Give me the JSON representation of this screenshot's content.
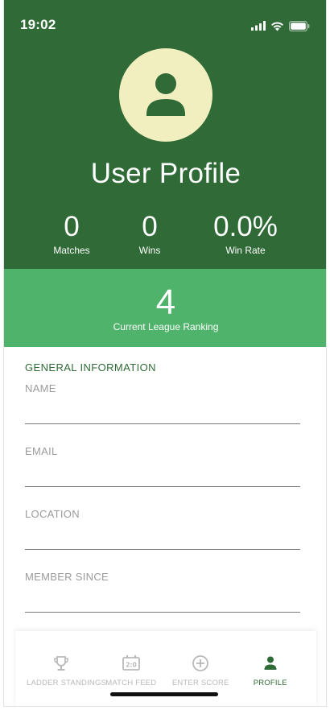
{
  "status_bar": {
    "time": "19:02"
  },
  "profile": {
    "title": "User Profile",
    "stats": [
      {
        "value": "0",
        "label": "Matches"
      },
      {
        "value": "0",
        "label": "Wins"
      },
      {
        "value": "0.0%",
        "label": "Win Rate"
      }
    ],
    "ranking": {
      "value": "4",
      "label": "Current League Ranking"
    }
  },
  "general_info": {
    "section_title": "GENERAL INFORMATION",
    "fields": [
      {
        "label": "NAME",
        "value": ""
      },
      {
        "label": "EMAIL",
        "value": ""
      },
      {
        "label": "LOCATION",
        "value": ""
      },
      {
        "label": "MEMBER SINCE",
        "value": ""
      }
    ]
  },
  "bottom_nav": {
    "items": [
      {
        "label": "LADDER STANDINGS",
        "icon": "trophy-icon",
        "active": false
      },
      {
        "label": "MATCH FEED",
        "icon": "scoreboard-icon",
        "active": false
      },
      {
        "label": "ENTER SCORE",
        "icon": "add-circle-icon",
        "active": false
      },
      {
        "label": "PROFILE",
        "icon": "person-icon",
        "active": true
      }
    ]
  },
  "colors": {
    "header_green": "#2f6a37",
    "ranking_green": "#4fb36b",
    "avatar_bg": "#f1efbf",
    "inactive_nav": "#b9b9b9"
  }
}
